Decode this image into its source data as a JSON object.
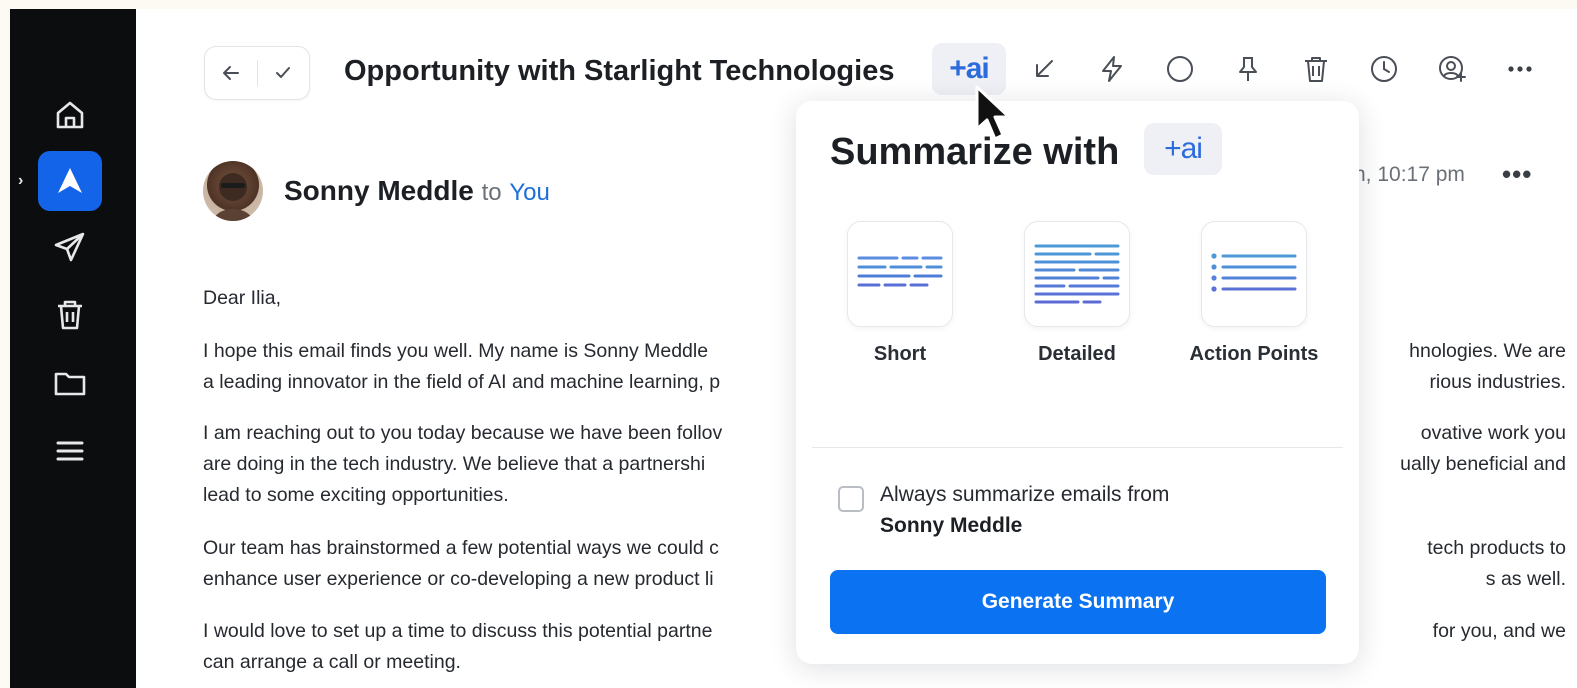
{
  "sidebar": {
    "items": [
      {
        "icon": "home-icon"
      },
      {
        "icon": "spark-app-icon",
        "active": true
      },
      {
        "icon": "send-icon"
      },
      {
        "icon": "trash-icon"
      },
      {
        "icon": "folder-icon"
      },
      {
        "icon": "menu-icon"
      }
    ],
    "expand_glyph": "›",
    "accent": "#1464ea"
  },
  "header": {
    "subject": "Opportunity with Starlight Technologies",
    "ai_label": "+ai",
    "toolbar_icons": [
      "ai-icon",
      "move-down-icon",
      "bolt-icon",
      "circle-icon",
      "pin-icon",
      "trash-icon",
      "clock-icon",
      "add-user-icon",
      "more-icon"
    ]
  },
  "message": {
    "sender": "Sonny Meddle",
    "to_word": "to",
    "recipient": "You",
    "date": "n, 10:17 pm",
    "more": "•••",
    "greeting": "Dear Ilia,",
    "paragraphs": [
      {
        "line1_left": "I hope this email finds you well. My name is  Sonny Meddle",
        "line1_right": "hnologies. We are",
        "line2_left": "a leading innovator in the field of AI and machine learning, p",
        "line2_right": "rious industries."
      },
      {
        "line1_left": "I am reaching out to you today because we have been follov",
        "line1_right": "ovative work you",
        "line2_left": "are doing in the tech industry. We believe that a partnershi",
        "line2_right": "ually beneficial and",
        "line3_left": "lead to some exciting opportunities."
      },
      {
        "line1_left": "Our team has brainstormed a few potential ways we could c",
        "line1_right": "tech products to",
        "line2_left": "enhance user experience or co-developing a new product li",
        "line2_right": "s as well."
      },
      {
        "line1_left": "I would love to set up a time to discuss this potential partne",
        "line1_right": "for you, and we",
        "line2_left": "can arrange a call or meeting."
      }
    ]
  },
  "summarize_popup": {
    "title": "Summarize with",
    "badge": "+ai",
    "options": [
      {
        "label": "Short"
      },
      {
        "label": "Detailed"
      },
      {
        "label": "Action Points"
      }
    ],
    "always_text": "Always summarize emails from",
    "always_name": "Sonny Meddle",
    "always_checked": false,
    "generate_label": "Generate Summary",
    "button_color": "#0b73f2"
  }
}
